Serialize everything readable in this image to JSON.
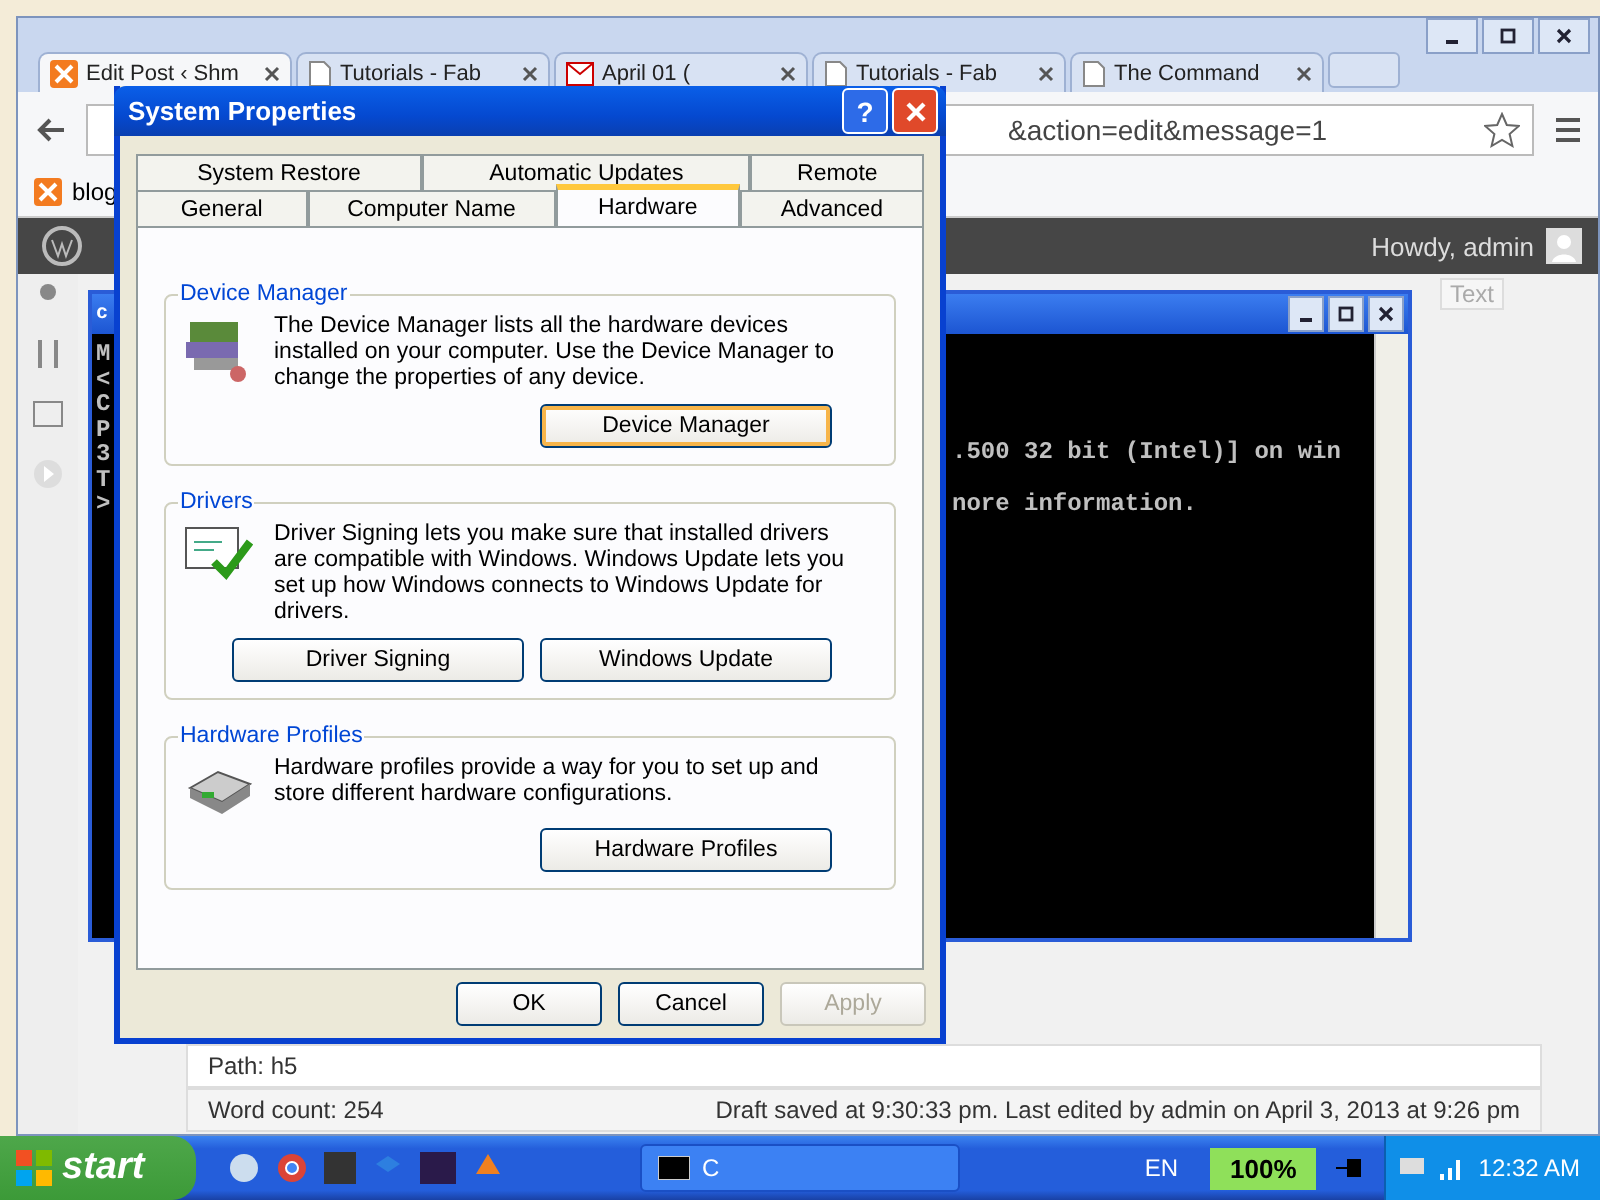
{
  "browser": {
    "tabs": [
      {
        "title": "Edit Post ‹ Shm",
        "kind": "xampp",
        "selected": true
      },
      {
        "title": "Tutorials - Fab",
        "kind": "doc",
        "selected": false
      },
      {
        "title": "April 01 (",
        "kind": "mail",
        "selected": false
      },
      {
        "title": "Tutorials - Fab",
        "kind": "doc",
        "selected": false
      },
      {
        "title": "The Command",
        "kind": "doc",
        "selected": false
      }
    ],
    "address": "&action=edit&message=1",
    "bookmark": "blog",
    "greeting": "Howdy, admin",
    "editor_tab": "Text",
    "path": "Path: h5",
    "word_count": "Word count: 254",
    "status": "Draft saved at 9:30:33 pm. Last edited by admin on April 3, 2013 at 9:26 pm"
  },
  "console": {
    "title": "c",
    "left_lines": [
      "M",
      "<",
      "C",
      "P",
      "3",
      "T",
      ">"
    ],
    "right_lines": [
      ".500 32 bit (Intel)] on win",
      "nore information."
    ]
  },
  "dialog": {
    "title": "System Properties",
    "help": "?",
    "tab_rows": [
      [
        {
          "label": "System Restore",
          "selected": false
        },
        {
          "label": "Automatic Updates",
          "selected": false
        },
        {
          "label": "Remote",
          "selected": false
        }
      ],
      [
        {
          "label": "General",
          "selected": false
        },
        {
          "label": "Computer Name",
          "selected": false
        },
        {
          "label": "Hardware",
          "selected": true
        },
        {
          "label": "Advanced",
          "selected": false
        }
      ]
    ],
    "groups": [
      {
        "title": "Device Manager",
        "kind": "devices",
        "text": "The Device Manager lists all the hardware devices installed on your computer. Use the Device Manager to change the properties of any device.",
        "buttons": [
          {
            "label": "Device Manager",
            "focused": true
          }
        ]
      },
      {
        "title": "Drivers",
        "kind": "drivers",
        "text": "Driver Signing lets you make sure that installed drivers are compatible with Windows. Windows Update lets you set up how Windows connects to Windows Update for drivers.",
        "buttons": [
          {
            "label": "Driver Signing",
            "focused": false
          },
          {
            "label": "Windows Update",
            "focused": false
          }
        ]
      },
      {
        "title": "Hardware Profiles",
        "kind": "profiles",
        "text": "Hardware profiles provide a way for you to set up and store different hardware configurations.",
        "buttons": [
          {
            "label": "Hardware Profiles",
            "focused": false
          }
        ]
      }
    ],
    "buttons": [
      {
        "label": "OK",
        "disabled": false
      },
      {
        "label": "Cancel",
        "disabled": false
      },
      {
        "label": "Apply",
        "disabled": true
      }
    ]
  },
  "taskbar": {
    "start": "start",
    "tasks": [
      {
        "label": "C"
      }
    ],
    "language": "EN",
    "meter": "100%",
    "clock": "12:32 AM"
  }
}
